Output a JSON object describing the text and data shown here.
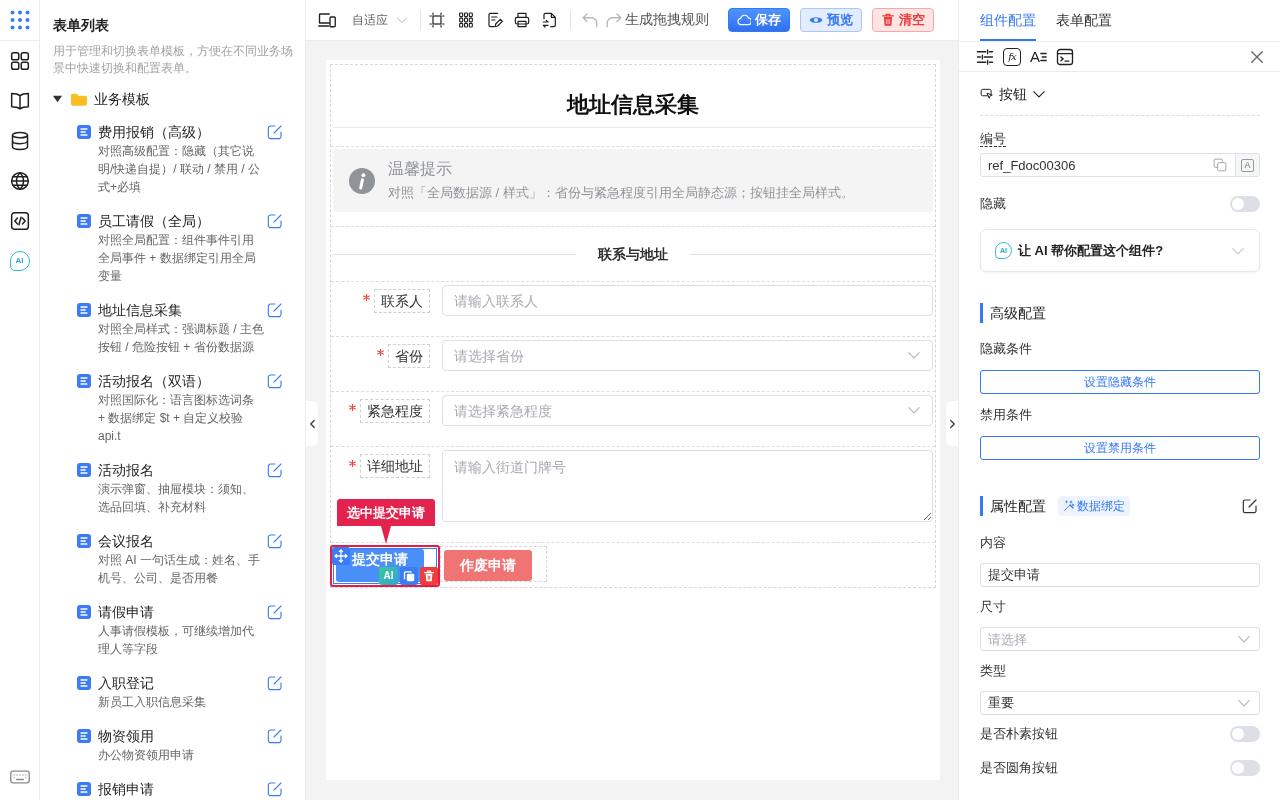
{
  "rail": {
    "ai_badge": "AI"
  },
  "sidebar": {
    "title": "表单列表",
    "description": "用于管理和切换表单模板，方便在不同业务场景中快速切换和配置表单。",
    "tree": [
      {
        "label": "业务模板",
        "expanded": true,
        "children": [
          {
            "title": "费用报销（高级）",
            "description": "对照高级配置：隐藏（其它说明/快递自提）/ 联动 / 禁用 / 公式+必填"
          },
          {
            "title": "员工请假（全局）",
            "description": "对照全局配置：组件事件引用全局事件 + 数据绑定引用全局变量"
          },
          {
            "title": "地址信息采集",
            "description": "对照全局样式：强调标题 / 主色按钮 / 危险按钮 + 省份数据源"
          },
          {
            "title": "活动报名（双语）",
            "description": "对照国际化：语言图标选词条 + 数据绑定 $t + 自定义校验 api.t"
          },
          {
            "title": "活动报名",
            "description": "演示弹窗、抽屉模块：须知、选品回填、补充材料"
          },
          {
            "title": "会议报名",
            "description": "对照 AI 一句话生成：姓名、手机号、公司、是否用餐"
          },
          {
            "title": "请假申请",
            "description": "人事请假模板，可继续增加代理人等字段"
          },
          {
            "title": "入职登记",
            "description": "新员工入职信息采集"
          },
          {
            "title": "物资领用",
            "description": "办公物资领用申请"
          },
          {
            "title": "报销申请"
          }
        ]
      }
    ]
  },
  "toolbar": {
    "device_select": {
      "value": "自适应"
    },
    "history": [
      {
        "kind": "undo",
        "disabled": true
      },
      {
        "kind": "redo",
        "disabled": true
      }
    ],
    "rule_button": "生成拖拽规则",
    "actions": [
      {
        "kind": "primary",
        "label": "保存"
      },
      {
        "kind": "info",
        "label": "预览"
      },
      {
        "kind": "danger",
        "label": "清空"
      }
    ]
  },
  "canvas": {
    "widgets": [
      {
        "kind": "title",
        "text": "地址信息采集"
      },
      {
        "kind": "alert",
        "title": "温馨提示",
        "text": "对照「全局数据源 / 样式」：省份与紧急程度引用全局静态源；按钮挂全局样式。"
      },
      {
        "kind": "divider",
        "text": "联系与地址"
      },
      {
        "kind": "input",
        "label": "联系人",
        "required": true,
        "placeholder": "请输入联系人"
      },
      {
        "kind": "select",
        "label": "省份",
        "required": true,
        "placeholder": "请选择省份"
      },
      {
        "kind": "select",
        "label": "紧急程度",
        "required": true,
        "placeholder": "请选择紧急程度"
      },
      {
        "kind": "textarea",
        "label": "详细地址",
        "required": true,
        "placeholder": "请输入街道门牌号"
      },
      {
        "kind": "buttons",
        "items": [
          {
            "kind": "primary",
            "label": "提交申请",
            "selected": true
          },
          {
            "kind": "danger",
            "label": "作废申请",
            "selected": false
          }
        ]
      }
    ],
    "selection": {
      "tip": "选中提交申请",
      "ai_badge": "AI"
    }
  },
  "panel": {
    "tabs": [
      {
        "label": "组件配置",
        "selected": true
      },
      {
        "label": "表单配置",
        "selected": false
      }
    ],
    "tools": [
      {
        "kind": "sliders"
      },
      {
        "kind": "formula",
        "glyph": "fx"
      },
      {
        "kind": "text_style",
        "glyph": "A"
      },
      {
        "kind": "console"
      }
    ],
    "component": {
      "label": "按钮"
    },
    "fields": [
      {
        "kind": "ref",
        "label": "编号",
        "value": "ref_Fdoc00306",
        "addon": "A"
      },
      {
        "kind": "switch",
        "label": "隐藏",
        "on": false
      },
      {
        "kind": "ai_card",
        "badge": "AI",
        "text": "让 AI 帮你配置这个组件?",
        "expanded": false
      },
      {
        "kind": "section",
        "title": "高级配置",
        "editable": false
      },
      {
        "kind": "action",
        "label": "隐藏条件",
        "button": "设置隐藏条件"
      },
      {
        "kind": "action",
        "label": "禁用条件",
        "button": "设置禁用条件"
      },
      {
        "kind": "section",
        "title": "属性配置",
        "tag": "数据绑定",
        "editable": true
      },
      {
        "kind": "text",
        "label": "内容",
        "value": "提交申请"
      },
      {
        "kind": "select",
        "label": "尺寸",
        "placeholder": "请选择"
      },
      {
        "kind": "select",
        "label": "类型",
        "value": "重要"
      },
      {
        "kind": "switch",
        "label": "是否朴素按钮",
        "on": false
      },
      {
        "kind": "switch",
        "label": "是否圆角按钮",
        "on": false
      }
    ]
  }
}
